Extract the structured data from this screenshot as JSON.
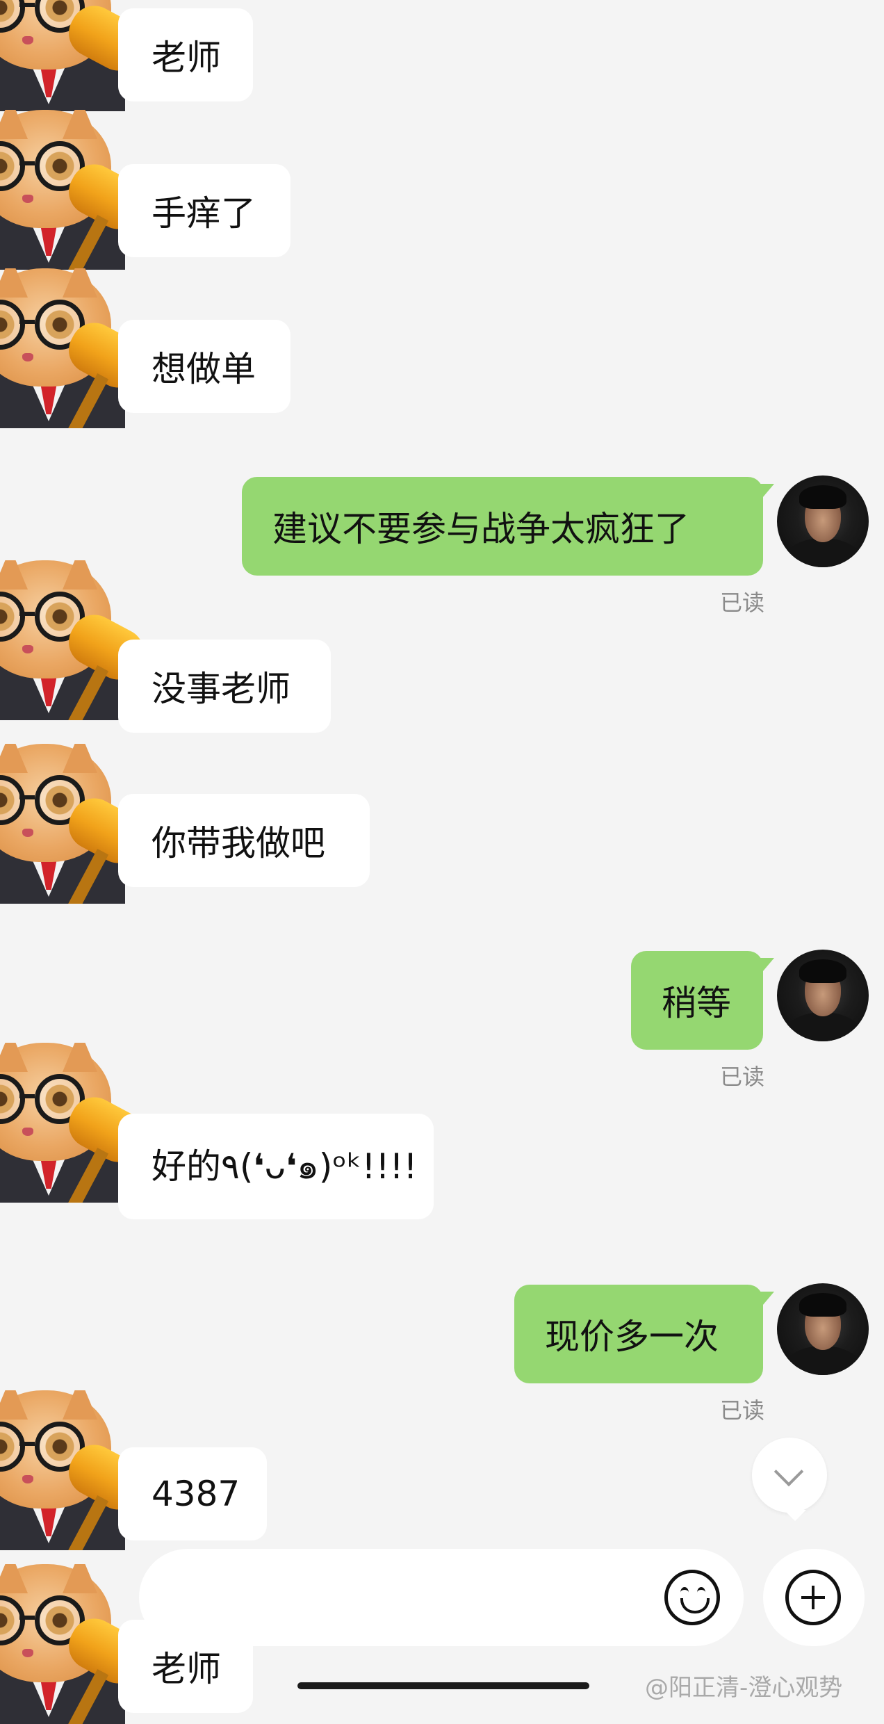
{
  "messages": [
    {
      "side": "in",
      "text": "老师"
    },
    {
      "side": "in",
      "text": "手痒了"
    },
    {
      "side": "in",
      "text": "想做单"
    },
    {
      "side": "out",
      "text": "建议不要参与战争太疯狂了",
      "status": "已读"
    },
    {
      "side": "in",
      "text": "没事老师"
    },
    {
      "side": "in",
      "text": "你带我做吧"
    },
    {
      "side": "out",
      "text": "稍等",
      "status": "已读"
    },
    {
      "side": "in",
      "text": "好的٩(❛ᴗ❛๑)ᵒᵏ!!!!"
    },
    {
      "side": "out",
      "text": "现价多一次",
      "status": "已读"
    },
    {
      "side": "in",
      "text": "4387"
    },
    {
      "side": "in",
      "text": "老师"
    }
  ],
  "input": {
    "placeholder": ""
  },
  "icons": {
    "emoji": "smiley-icon",
    "plus": "plus-circle-icon",
    "scroll": "chevron-down-icon"
  },
  "watermark": "@阳正清-澄心观势",
  "colors": {
    "outgoing_bubble": "#95d771",
    "incoming_bubble": "#ffffff",
    "background": "#f4f4f4"
  }
}
